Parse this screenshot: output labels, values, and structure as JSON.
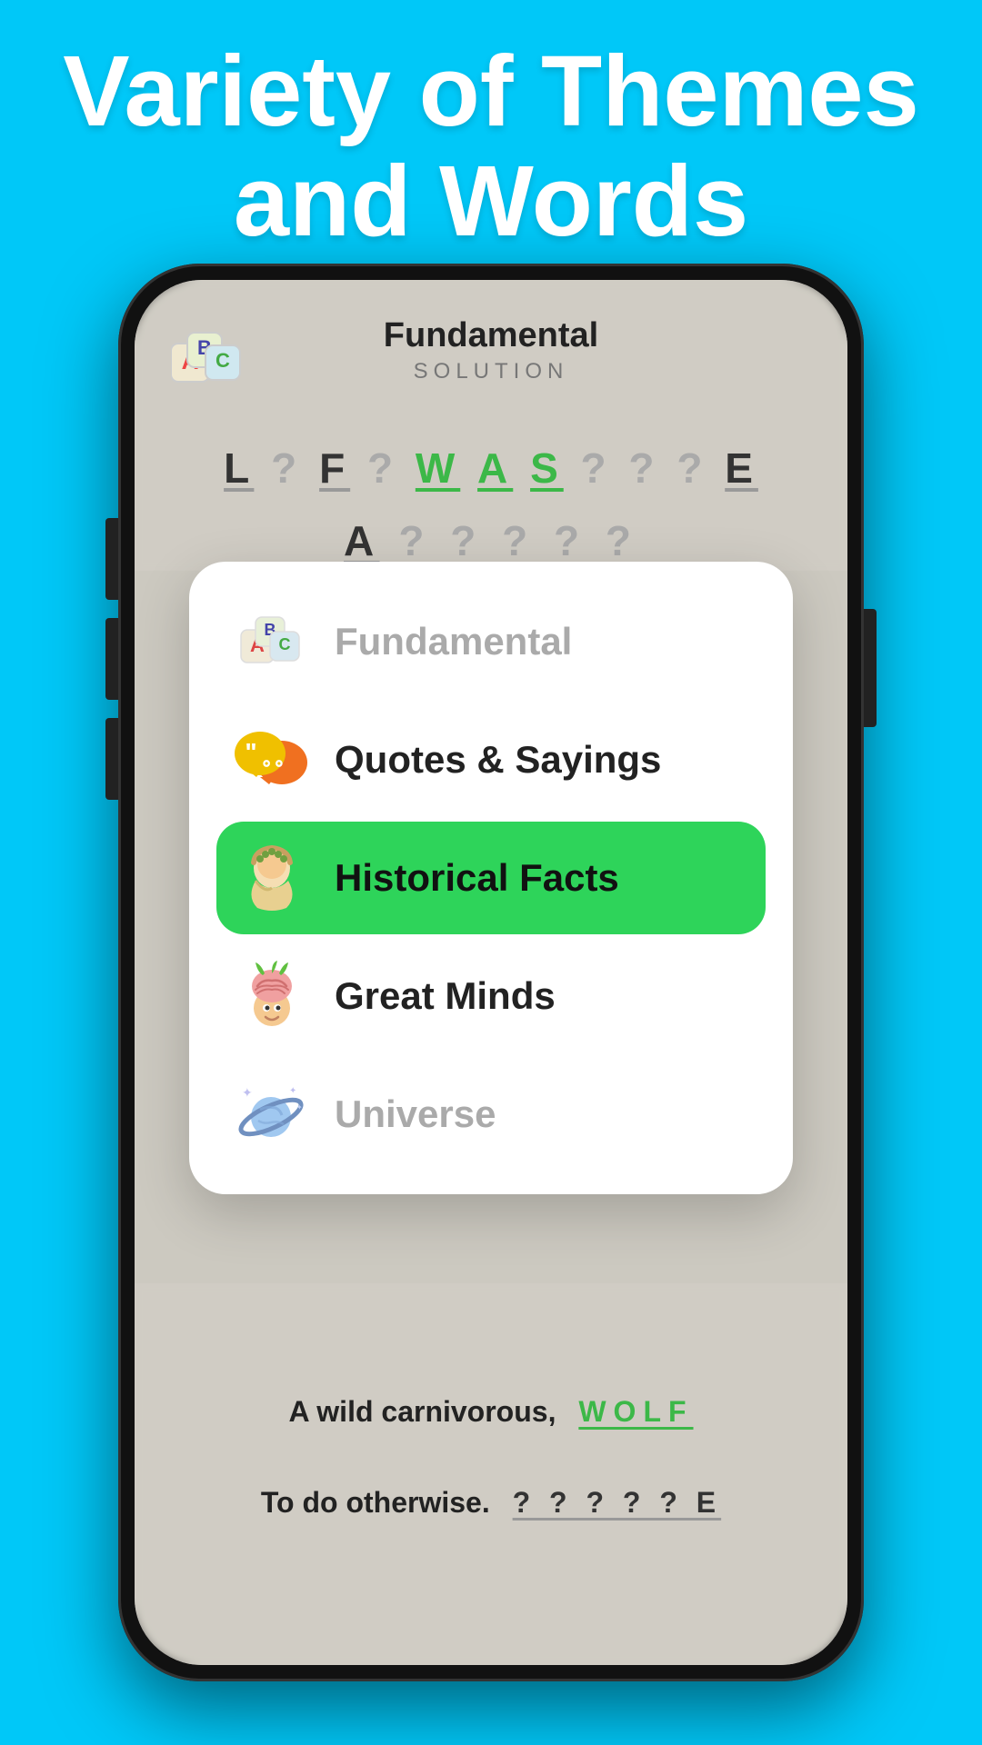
{
  "hero": {
    "title_line1": "Variety of Themes",
    "title_line2": "and Words",
    "title_combined": "Variety of Themes and Words"
  },
  "app": {
    "title": "Fundamental",
    "subtitle": "SOLUTION"
  },
  "letter_row1": {
    "display": "L ? F ? W A S ? ? ? E"
  },
  "letter_row2": {
    "display": "A ? ? ? ? ?"
  },
  "menu": {
    "items": [
      {
        "id": "fundamental",
        "label": "Fundamental",
        "icon": "abc-blocks",
        "active": false,
        "muted": true
      },
      {
        "id": "quotes",
        "label": "Quotes & Sayings",
        "icon": "speech-bubbles",
        "active": false,
        "muted": false
      },
      {
        "id": "historical",
        "label": "Historical Facts",
        "icon": "historical-person",
        "active": true,
        "muted": false
      },
      {
        "id": "great-minds",
        "label": "Great Minds",
        "icon": "brain-person",
        "active": false,
        "muted": false
      },
      {
        "id": "universe",
        "label": "Universe",
        "icon": "planet",
        "active": false,
        "muted": true
      }
    ]
  },
  "bottom_clues": [
    {
      "clue": "A wild carnivorous,",
      "answer": "WOLF",
      "answer_color": "#3cb848"
    },
    {
      "clue": "To do otherwise.",
      "answer": "? ? ? ? ? E",
      "answer_color": "#333"
    }
  ],
  "colors": {
    "background": "#00c8f8",
    "active_green": "#2ed45a",
    "answer_green": "#3cb848",
    "white": "#ffffff"
  }
}
